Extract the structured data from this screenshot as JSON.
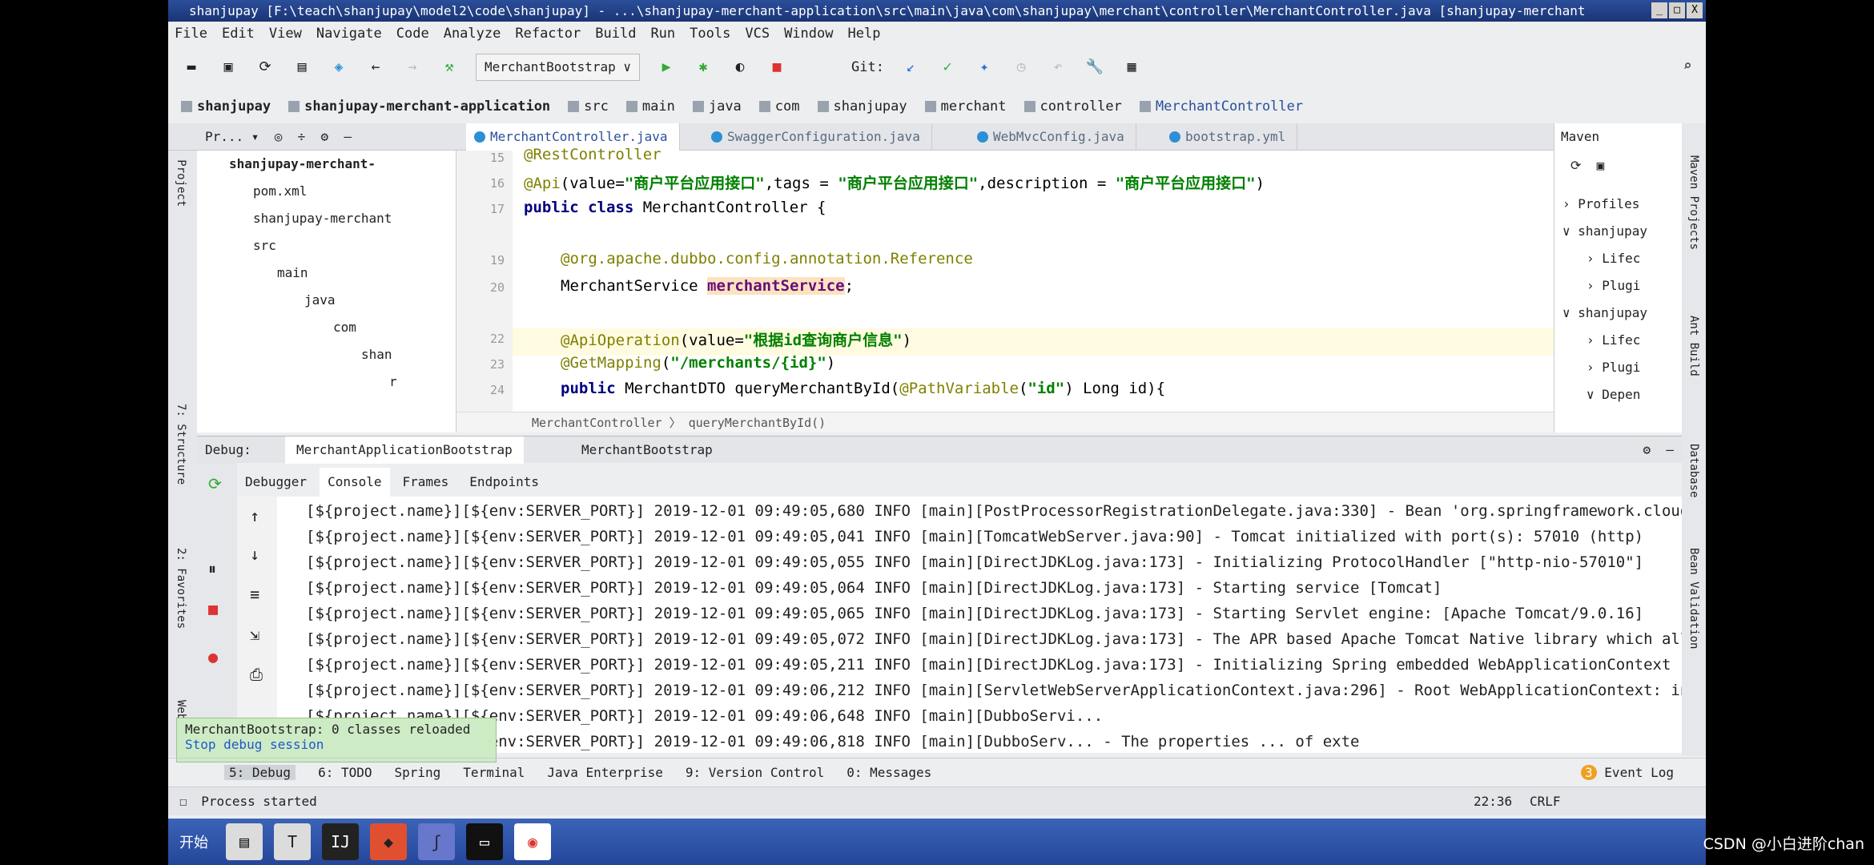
{
  "window": {
    "title": "shanjupay [F:\\teach\\shanjupay\\model2\\code\\shanjupay] - ...\\shanjupay-merchant-application\\src\\main\\java\\com\\shanjupay\\merchant\\controller\\MerchantController.java [shanjupay-merchant"
  },
  "menu": [
    "File",
    "Edit",
    "View",
    "Navigate",
    "Code",
    "Analyze",
    "Refactor",
    "Build",
    "Run",
    "Tools",
    "VCS",
    "Window",
    "Help"
  ],
  "toolbar": {
    "run_config": "MerchantBootstrap",
    "git_label": "Git:"
  },
  "breadcrumbs": [
    "shanjupay",
    "shanjupay-merchant-application",
    "src",
    "main",
    "java",
    "com",
    "shanjupay",
    "merchant",
    "controller",
    "MerchantController"
  ],
  "editor_tabs": [
    "MerchantController.java",
    "SwaggerConfiguration.java",
    "WebMvcConfig.java",
    "bootstrap.yml"
  ],
  "project": {
    "label": "Pr...",
    "tree": [
      "shanjupay-merchant-",
      "pom.xml",
      "shanjupay-merchant",
      "src",
      "main",
      "java",
      "com",
      "shan",
      "r"
    ]
  },
  "code": [
    {
      "ln": "15",
      "text": "@RestController"
    },
    {
      "ln": "16",
      "a": "@Api",
      "b": "(value=",
      "s1": "\"商户平台应用接口\"",
      "c": ",tags = ",
      "s2": "\"商户平台应用接口\"",
      "d": ",description = ",
      "s3": "\"商户平台应用接口\"",
      "e": ")"
    },
    {
      "ln": "17",
      "kw": "public class ",
      "rest": "MerchantController {"
    },
    {
      "ln": "19",
      "text": "@org.apache.dubbo.config.annotation.Reference"
    },
    {
      "ln": "20",
      "t": "MerchantService ",
      "f": "merchantService",
      ";": ";"
    },
    {
      "ln": "22",
      "a": "@ApiOperation",
      "b": "(value=",
      "s": "\"根据id查询商户信息\"",
      "e": ")"
    },
    {
      "ln": "23",
      "a": "@GetMapping",
      "b": "(",
      "s": "\"/merchants/{id}\"",
      "e": ")"
    },
    {
      "ln": "24",
      "kw": "public ",
      "rest": "MerchantDTO queryMerchantById(",
      "a": "@PathVariable",
      "b": "(",
      "s": "\"id\"",
      "e": ") Long id){"
    }
  ],
  "editor_breadcrumb": [
    "MerchantController",
    "queryMerchantById()"
  ],
  "maven": {
    "title": "Maven",
    "items": [
      "Profiles",
      "shanjupay",
      "Lifec",
      "Plugi",
      "shanjupay",
      "Lifec",
      "Plugi",
      "Depen"
    ]
  },
  "right_strip": [
    "Maven Projects",
    "Ant Build",
    "Database",
    "Bean Validation"
  ],
  "left_strip": [
    "1: Project",
    "7: Structure",
    "2: Favorites",
    "Web"
  ],
  "debug": {
    "label": "Debug:",
    "sessions": [
      "MerchantApplicationBootstrap",
      "MerchantBootstrap"
    ],
    "tabs": [
      "Debugger",
      "Console",
      "Frames",
      "Endpoints"
    ]
  },
  "console": [
    "[${project.name}][${env:SERVER_PORT}] 2019-12-01 09:49:05,680 INFO [main][PostProcessorRegistrationDelegate.java:330] - Bean 'org.springframework.cloud.au",
    "[${project.name}][${env:SERVER_PORT}] 2019-12-01 09:49:05,041 INFO [main][TomcatWebServer.java:90] - Tomcat initialized with port(s): 57010 (http)",
    "[${project.name}][${env:SERVER_PORT}] 2019-12-01 09:49:05,055 INFO [main][DirectJDKLog.java:173] - Initializing ProtocolHandler [\"http-nio-57010\"]",
    "[${project.name}][${env:SERVER_PORT}] 2019-12-01 09:49:05,064 INFO [main][DirectJDKLog.java:173] - Starting service [Tomcat]",
    "[${project.name}][${env:SERVER_PORT}] 2019-12-01 09:49:05,065 INFO [main][DirectJDKLog.java:173] - Starting Servlet engine: [Apache Tomcat/9.0.16]",
    "[${project.name}][${env:SERVER_PORT}] 2019-12-01 09:49:05,072 INFO [main][DirectJDKLog.java:173] - The APR based Apache Tomcat Native library which allows",
    "[${project.name}][${env:SERVER_PORT}] 2019-12-01 09:49:05,211 INFO [main][DirectJDKLog.java:173] - Initializing Spring embedded WebApplicationContext",
    "[${project.name}][${env:SERVER_PORT}] 2019-12-01 09:49:06,212 INFO [main][ServletWebServerApplicationContext.java:296] - Root WebApplicationContext: initi",
    "[${project.name}][${env:SERVER_PORT}] 2019-12-01 09:49:06,648 INFO [main][DubboServi...",
    "[${project.name}][${env:SERVER_PORT}] 2019-12-01 09:49:06,818 INFO [main][DubboServ... - The properties ... of exte"
  ],
  "notification": {
    "text": "MerchantBootstrap: 0 classes reloaded",
    "link": "Stop debug session"
  },
  "bottom_tabs": [
    "5: Debug",
    "6: TODO",
    "Spring",
    "Terminal",
    "Java Enterprise",
    "9: Version Control",
    "0: Messages"
  ],
  "event_log": {
    "count": "3",
    "label": "Event Log"
  },
  "status": {
    "message": "Process started",
    "position": "22:36",
    "line_ending": "CRLF"
  },
  "taskbar": {
    "start": "开始"
  },
  "watermark": "CSDN @小白进阶chan"
}
